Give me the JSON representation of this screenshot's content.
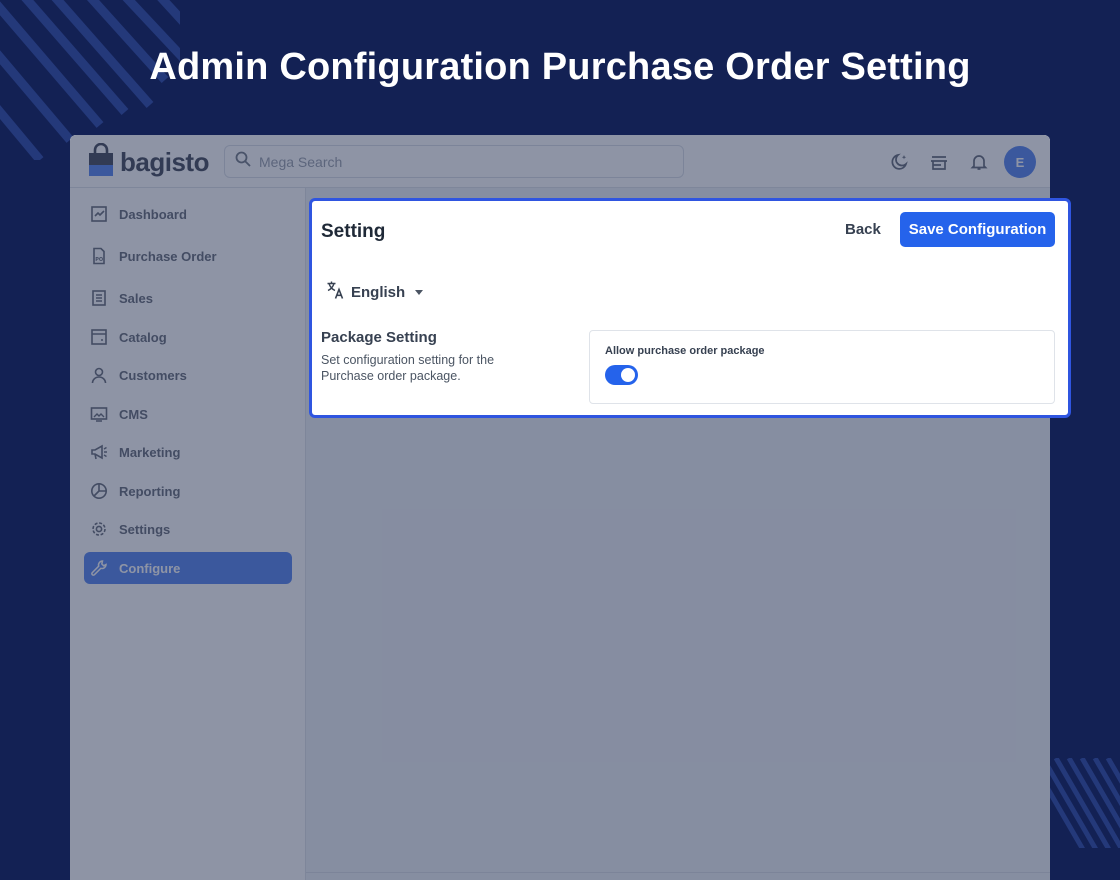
{
  "banner": {
    "title": "Admin Configuration Purchase Order Setting"
  },
  "colors": {
    "background": "#132154",
    "accent": "#2563eb",
    "highlight_border": "#2f55e0"
  },
  "topbar": {
    "logo_text": "bagisto",
    "search_placeholder": "Mega Search",
    "icons": [
      "dark-mode-icon",
      "storefront-icon",
      "notification-bell-icon"
    ],
    "avatar_initial": "E"
  },
  "sidebar": {
    "items": [
      {
        "label": "Dashboard",
        "icon": "dashboard-icon",
        "active": false
      },
      {
        "label": "Purchase Order",
        "icon": "purchase-order-icon",
        "active": false
      },
      {
        "label": "Sales",
        "icon": "sales-icon",
        "active": false
      },
      {
        "label": "Catalog",
        "icon": "catalog-icon",
        "active": false
      },
      {
        "label": "Customers",
        "icon": "customers-icon",
        "active": false
      },
      {
        "label": "CMS",
        "icon": "cms-icon",
        "active": false
      },
      {
        "label": "Marketing",
        "icon": "marketing-icon",
        "active": false
      },
      {
        "label": "Reporting",
        "icon": "reporting-icon",
        "active": false
      },
      {
        "label": "Settings",
        "icon": "settings-icon",
        "active": false
      },
      {
        "label": "Configure",
        "icon": "configure-icon",
        "active": true
      }
    ]
  },
  "card": {
    "title": "Setting",
    "back_label": "Back",
    "save_label": "Save Configuration",
    "language": "English",
    "section_title": "Package Setting",
    "section_desc": "Set configuration setting for the Purchase order package.",
    "field_label": "Allow purchase order package",
    "toggle_on": true
  }
}
